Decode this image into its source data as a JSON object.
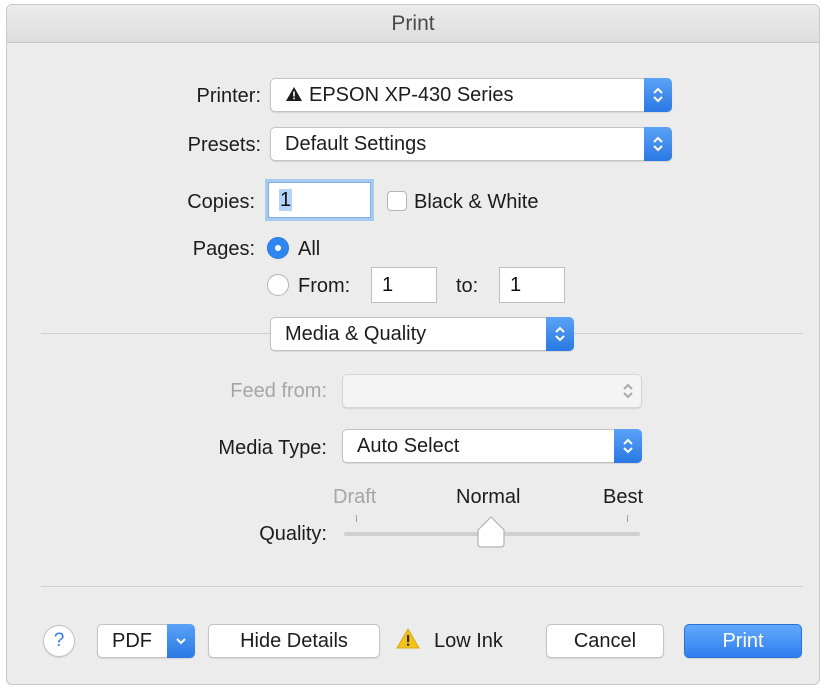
{
  "window": {
    "title": "Print"
  },
  "printer": {
    "label": "Printer:",
    "value": "EPSON XP-430 Series",
    "warning_icon": "warning-triangle-icon"
  },
  "presets": {
    "label": "Presets:",
    "value": "Default Settings"
  },
  "copies": {
    "label": "Copies:",
    "value": "1",
    "bw_label": "Black & White",
    "bw_checked": false
  },
  "pages": {
    "label": "Pages:",
    "all_label": "All",
    "all_selected": true,
    "from_label": "From:",
    "from_value": "1",
    "to_label": "to:",
    "to_value": "1"
  },
  "panel": {
    "value": "Media & Quality"
  },
  "feed": {
    "label": "Feed from:",
    "value": "",
    "enabled": false
  },
  "media_type": {
    "label": "Media Type:",
    "value": "Auto Select"
  },
  "quality": {
    "label": "Quality:",
    "levels": [
      "Draft",
      "Normal",
      "Best"
    ],
    "selected": "Normal",
    "draft_enabled": false
  },
  "footer": {
    "help_label": "?",
    "pdf_label": "PDF",
    "hide_details_label": "Hide Details",
    "low_ink_label": "Low Ink",
    "cancel_label": "Cancel",
    "print_label": "Print"
  },
  "colors": {
    "accent": "#2f7ef0",
    "warning": "#f2c21b"
  }
}
